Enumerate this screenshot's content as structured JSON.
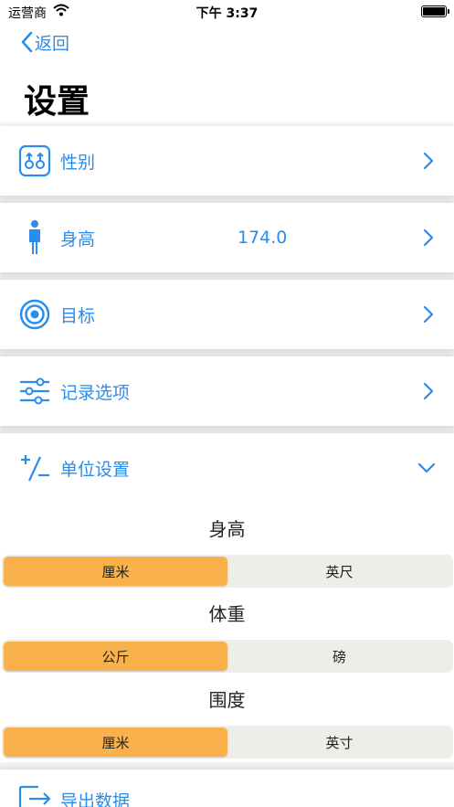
{
  "status_bar": {
    "carrier": "运营商",
    "time": "下午 3:37"
  },
  "nav": {
    "back_label": "返回",
    "title": "设置"
  },
  "rows": {
    "gender": {
      "label": "性别",
      "icon": "gender-icon"
    },
    "height": {
      "label": "身高",
      "value": "174.0",
      "icon": "person-icon"
    },
    "goal": {
      "label": "目标",
      "icon": "target-icon"
    },
    "record_options": {
      "label": "记录选项",
      "icon": "sliders-icon"
    },
    "units": {
      "label": "单位设置",
      "icon": "plus-minus-icon"
    },
    "export": {
      "label": "导出数据",
      "icon": "export-icon"
    }
  },
  "units": {
    "height": {
      "title": "身高",
      "options": [
        "厘米",
        "英尺"
      ],
      "selected": "厘米"
    },
    "weight": {
      "title": "体重",
      "options": [
        "公斤",
        "磅"
      ],
      "selected": "公斤"
    },
    "girth": {
      "title": "围度",
      "options": [
        "厘米",
        "英寸"
      ],
      "selected": "厘米"
    }
  },
  "colors": {
    "accent": "#2a8cec",
    "segment_active": "#f9b24b",
    "segment_bg": "#efedea"
  }
}
